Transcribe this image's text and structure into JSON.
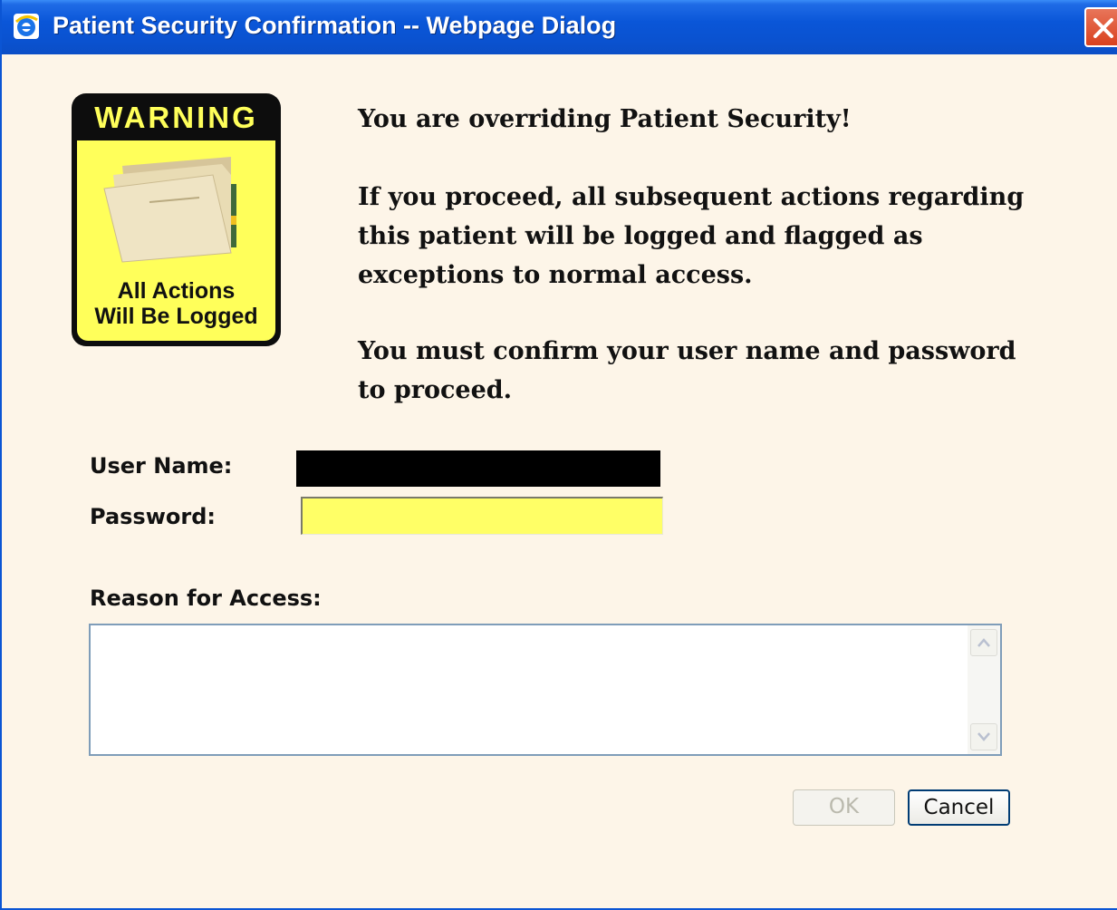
{
  "window": {
    "title": "Patient Security Confirmation -- Webpage Dialog",
    "title_bar_color": "#0a56d8",
    "background_color": "#fdf5e8"
  },
  "warning_sign": {
    "heading": "WARNING",
    "footer_line1": "All Actions",
    "footer_line2": "Will Be Logged",
    "sign_color": "#ffff5a"
  },
  "message": {
    "line1": "You are overriding Patient Security!",
    "line2": "If you proceed, all subsequent actions regarding this patient will be logged and flagged as exceptions to normal access.",
    "line3": "You must confirm your user name and password to proceed."
  },
  "form": {
    "user_name_label": "User Name:",
    "password_label": "Password:",
    "password_value": "",
    "reason_label": "Reason for Access:",
    "reason_value": "",
    "password_field_color": "#ffff66"
  },
  "buttons": {
    "ok_label": "OK",
    "cancel_label": "Cancel"
  },
  "icons": [
    "ie-icon",
    "close-icon",
    "folder-icon",
    "scroll-up-icon",
    "scroll-down-icon"
  ]
}
